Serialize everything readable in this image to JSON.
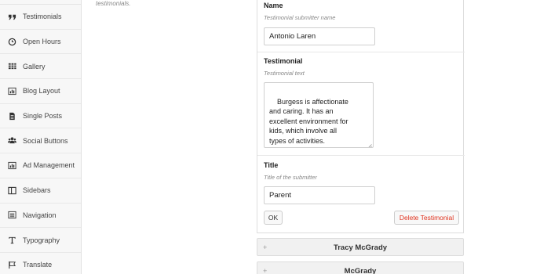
{
  "sidebar": {
    "items": [
      {
        "label": "Testimonials",
        "icon": "quote-icon"
      },
      {
        "label": "Open Hours",
        "icon": "clock-icon"
      },
      {
        "label": "Gallery",
        "icon": "grid-icon"
      },
      {
        "label": "Blog Layout",
        "icon": "bar-chart-icon"
      },
      {
        "label": "Single Posts",
        "icon": "document-icon"
      },
      {
        "label": "Social Buttons",
        "icon": "users-icon"
      },
      {
        "label": "Ad Management",
        "icon": "bar-chart-icon"
      },
      {
        "label": "Sidebars",
        "icon": "columns-icon"
      },
      {
        "label": "Navigation",
        "icon": "nav-list-icon"
      },
      {
        "label": "Typography",
        "icon": "typography-icon"
      },
      {
        "label": "Translate",
        "icon": "flag-icon"
      }
    ]
  },
  "hint_text": "testimonials.",
  "testimonial": {
    "name_label": "Name",
    "name_sub": "Testimonial submitter name",
    "name_value": "Antonio Laren",
    "text_label": "Testimonial",
    "text_sub": "Testimonial text",
    "text_value": "Burgess is affectionate\nand caring. It has an\nexcellent environment for\nkids, which involve all\ntypes of activities.",
    "title_label": "Title",
    "title_sub": "Title of the submitter",
    "title_value": "Parent",
    "ok_label": "OK",
    "delete_label": "Delete Testimonial"
  },
  "accordion": [
    {
      "plus": "+",
      "title": "Tracy McGrady"
    },
    {
      "plus": "+",
      "title": "McGrady"
    }
  ],
  "colors": {
    "delete_text": "#e0331f"
  }
}
